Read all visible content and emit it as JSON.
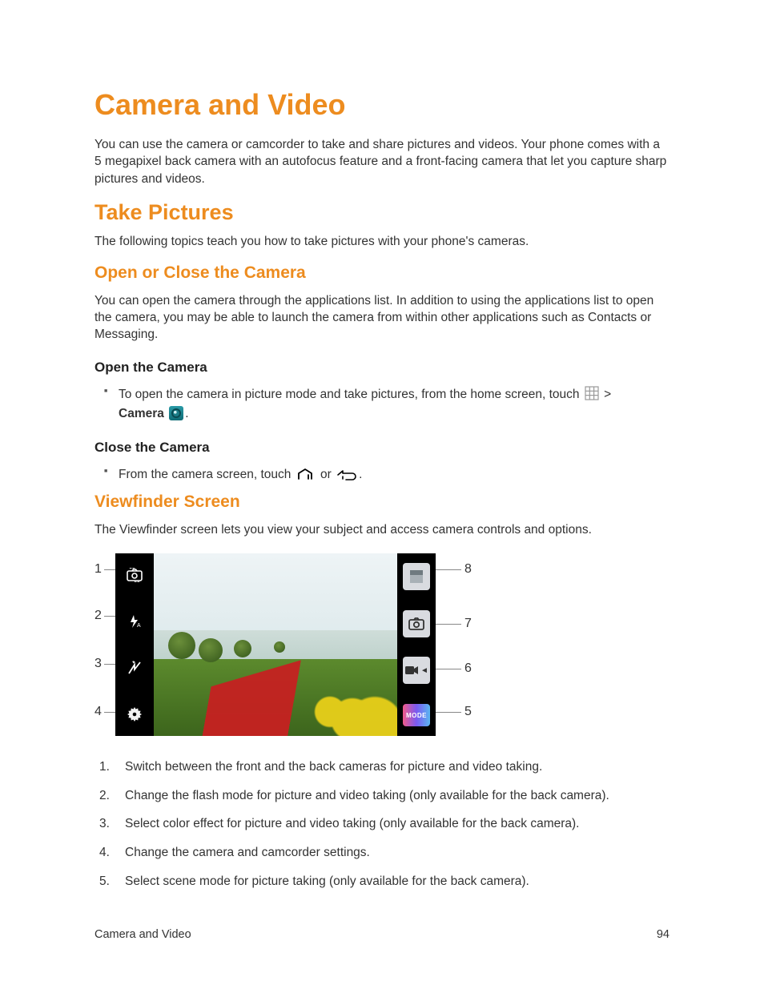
{
  "title": "Camera and Video",
  "intro": "You can use the camera or camcorder to take and share pictures and videos. Your phone comes with a 5 megapixel back camera with an autofocus feature and a front-facing camera that let you capture sharp pictures and videos.",
  "section_take_pictures": {
    "heading": "Take Pictures",
    "intro": "The following topics teach you how to take pictures with your phone's cameras."
  },
  "section_open_close": {
    "heading": "Open or Close the Camera",
    "intro": "You can open the camera through the applications list. In addition to using the applications list to open the camera, you may be able to launch the camera from within other applications such as Contacts or Messaging.",
    "open_heading": "Open the Camera",
    "open_bullet_pre": "To open the camera in picture mode and take pictures, from the home screen, touch ",
    "open_bullet_gt": " > ",
    "open_bullet_camera_label": "Camera ",
    "open_bullet_period": ".",
    "close_heading": "Close the Camera",
    "close_bullet_pre": "From the camera screen, touch ",
    "close_bullet_or": " or ",
    "close_bullet_period": "."
  },
  "section_viewfinder": {
    "heading": "Viewfinder Screen",
    "intro": "The Viewfinder screen lets you view your subject and access camera controls and options.",
    "callouts": {
      "c1": "1",
      "c2": "2",
      "c3": "3",
      "c4": "4",
      "c5": "5",
      "c6": "6",
      "c7": "7",
      "c8": "8"
    },
    "mode_label": "MODE",
    "items": [
      "Switch between the front and the back cameras for picture and video taking.",
      "Change the flash mode for picture and video taking (only available for the back camera).",
      "Select color effect for picture and video taking (only available for the back camera).",
      "Change the camera and camcorder settings.",
      "Select scene mode for picture taking (only available for the back camera)."
    ]
  },
  "footer": {
    "section": "Camera and Video",
    "page": "94"
  }
}
